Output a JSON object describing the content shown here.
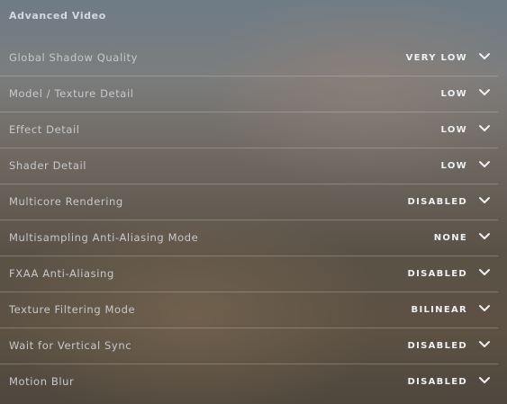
{
  "section": {
    "title": "Advanced Video"
  },
  "settings": [
    {
      "label": "Global Shadow Quality",
      "value": "VERY LOW",
      "icon": "chevron-down-icon"
    },
    {
      "label": "Model / Texture Detail",
      "value": "LOW",
      "icon": "chevron-down-icon"
    },
    {
      "label": "Effect Detail",
      "value": "LOW",
      "icon": "chevron-down-icon"
    },
    {
      "label": "Shader Detail",
      "value": "LOW",
      "icon": "chevron-down-icon"
    },
    {
      "label": "Multicore Rendering",
      "value": "DISABLED",
      "icon": "chevron-down-icon"
    },
    {
      "label": "Multisampling Anti-Aliasing Mode",
      "value": "NONE",
      "icon": "chevron-down-icon"
    },
    {
      "label": "FXAA Anti-Aliasing",
      "value": "DISABLED",
      "icon": "chevron-down-icon"
    },
    {
      "label": "Texture Filtering Mode",
      "value": "BILINEAR",
      "icon": "chevron-down-icon"
    },
    {
      "label": "Wait for Vertical Sync",
      "value": "DISABLED",
      "icon": "chevron-down-icon"
    },
    {
      "label": "Motion Blur",
      "value": "DISABLED",
      "icon": "chevron-down-icon"
    }
  ],
  "colors": {
    "text_label": "#c7c9cb",
    "text_value": "#eef0f2",
    "divider": "#e1e1e1"
  }
}
